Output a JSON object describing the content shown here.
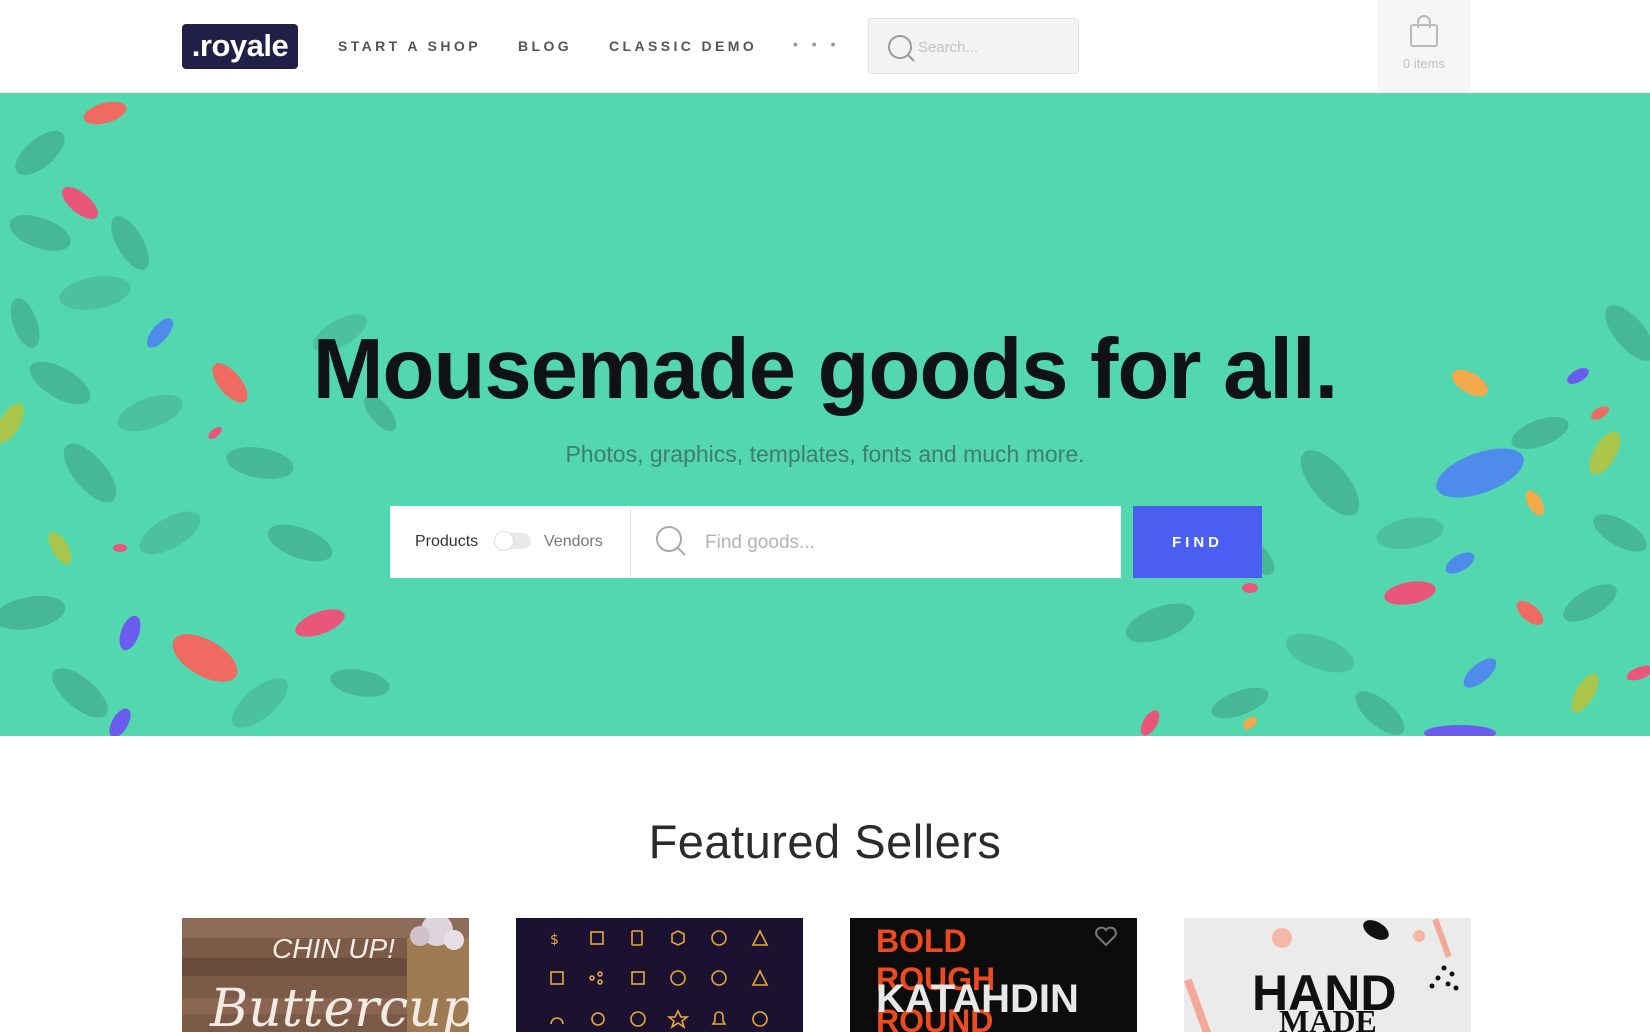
{
  "header": {
    "logo": ".royale",
    "nav": [
      "START A SHOP",
      "BLOG",
      "CLASSIC DEMO"
    ],
    "more": "• • •",
    "search_placeholder": "Search...",
    "cart_label": "0 items"
  },
  "hero": {
    "title": "Mousemade goods for all.",
    "subtitle": "Photos, graphics, templates, fonts and much more.",
    "toggle_left": "Products",
    "toggle_right": "Vendors",
    "find_placeholder": "Find goods...",
    "find_button": "FIND"
  },
  "featured": {
    "title": "Featured Sellers",
    "cards": [
      {
        "line1": "CHIN UP!",
        "line2": "Buttercup"
      },
      {
        "icons": "line-icon-set"
      },
      {
        "line1": "BOLD",
        "line2": "ROUGH",
        "line3": "KATAHDIN",
        "line4": "ROUND"
      },
      {
        "line1": "HAND",
        "line2": "MADE"
      }
    ]
  },
  "colors": {
    "brand": "#1f1f47",
    "hero_bg": "#52d7ae",
    "find_button": "#4a5ef2"
  }
}
